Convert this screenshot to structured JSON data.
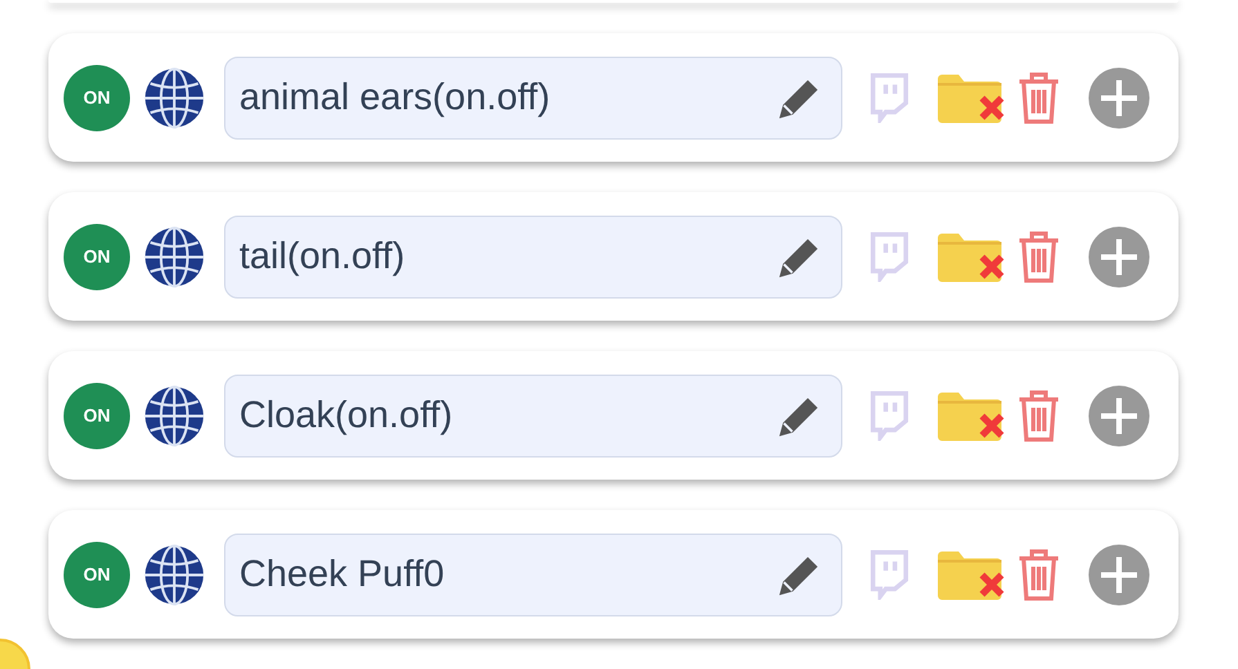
{
  "rows": [
    {
      "toggle": "ON",
      "on": true,
      "label": "animal ears(on.off)"
    },
    {
      "toggle": "ON",
      "on": true,
      "label": "tail(on.off)"
    },
    {
      "toggle": "ON",
      "on": true,
      "label": "Cloak(on.off)"
    },
    {
      "toggle": "ON",
      "on": true,
      "label": "Cheek Puff0"
    }
  ]
}
